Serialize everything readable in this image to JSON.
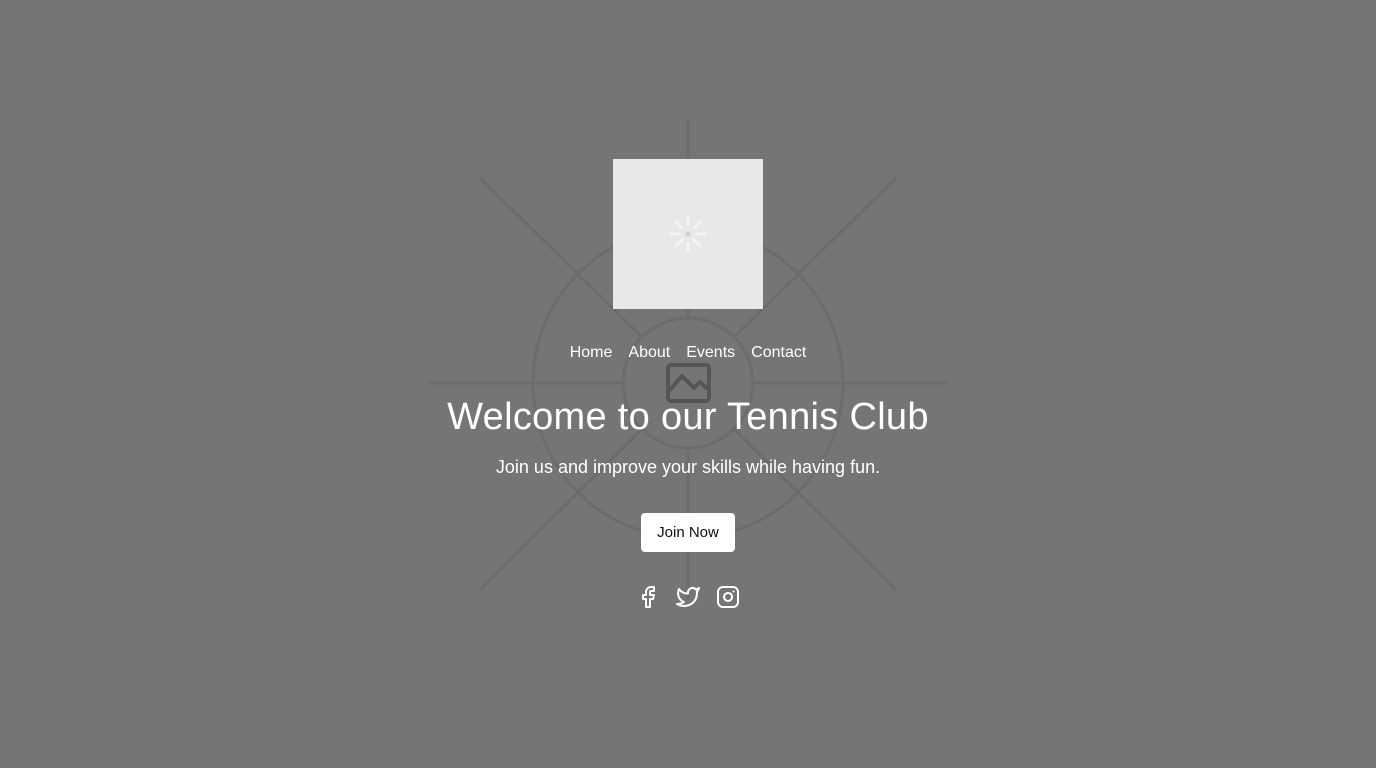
{
  "hero": {
    "background_icon": "image-placeholder-icon",
    "logo_icon": "loading-spinner-icon",
    "title": "Welcome to our Tennis Club",
    "subtitle": "Join us and improve your skills while having fun.",
    "cta_label": "Join Now"
  },
  "nav": {
    "items": [
      {
        "label": "Home"
      },
      {
        "label": "About"
      },
      {
        "label": "Events"
      },
      {
        "label": "Contact"
      }
    ]
  },
  "social": [
    {
      "icon": "facebook-icon"
    },
    {
      "icon": "twitter-icon"
    },
    {
      "icon": "instagram-icon"
    }
  ],
  "colors": {
    "background": "#757575",
    "logo_box": "#e8e8e8",
    "text": "#ffffff",
    "button_bg": "#ffffff",
    "button_text": "#111111"
  }
}
